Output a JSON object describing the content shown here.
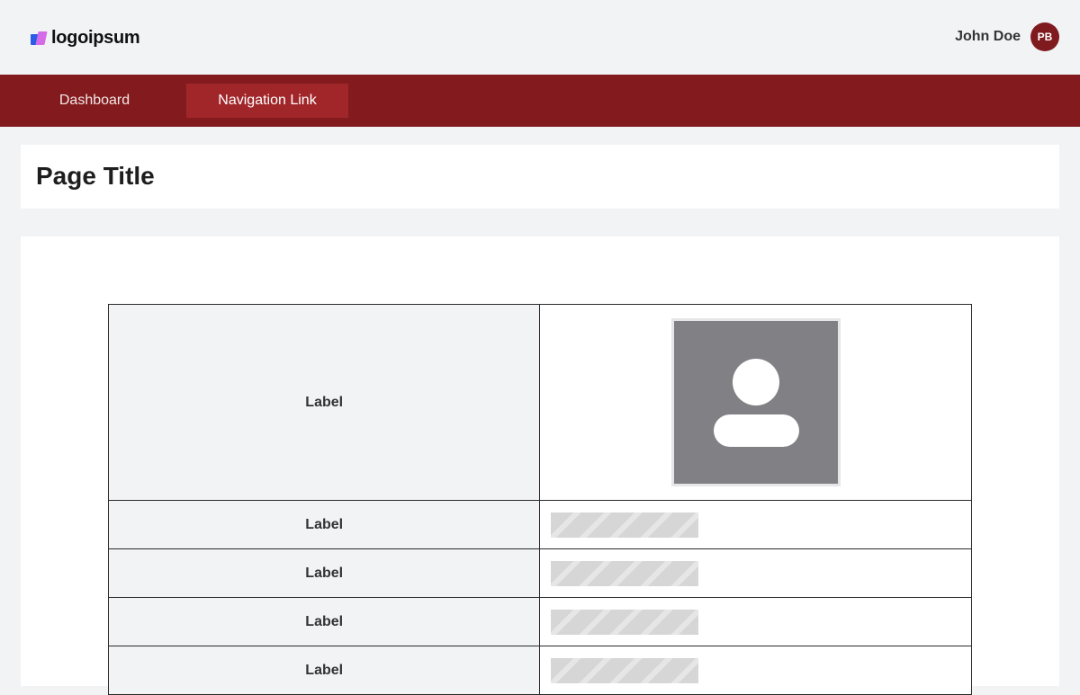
{
  "header": {
    "logo_text": "logoipsum",
    "user_name": "John Doe",
    "avatar_initials": "PB"
  },
  "nav": {
    "items": [
      {
        "label": "Dashboard",
        "active": false
      },
      {
        "label": "Navigation Link",
        "active": true
      }
    ]
  },
  "page": {
    "title": "Page Title"
  },
  "table": {
    "rows": [
      {
        "label": "Label",
        "value_type": "photo-placeholder"
      },
      {
        "label": "Label",
        "value_type": "text-placeholder"
      },
      {
        "label": "Label",
        "value_type": "text-placeholder"
      },
      {
        "label": "Label",
        "value_type": "text-placeholder"
      },
      {
        "label": "Label",
        "value_type": "text-placeholder"
      }
    ]
  },
  "colors": {
    "brand": "#831b1e",
    "nav_active": "#a1262a",
    "avatar_bg": "#7f1b1e",
    "background": "#f2f3f5"
  }
}
